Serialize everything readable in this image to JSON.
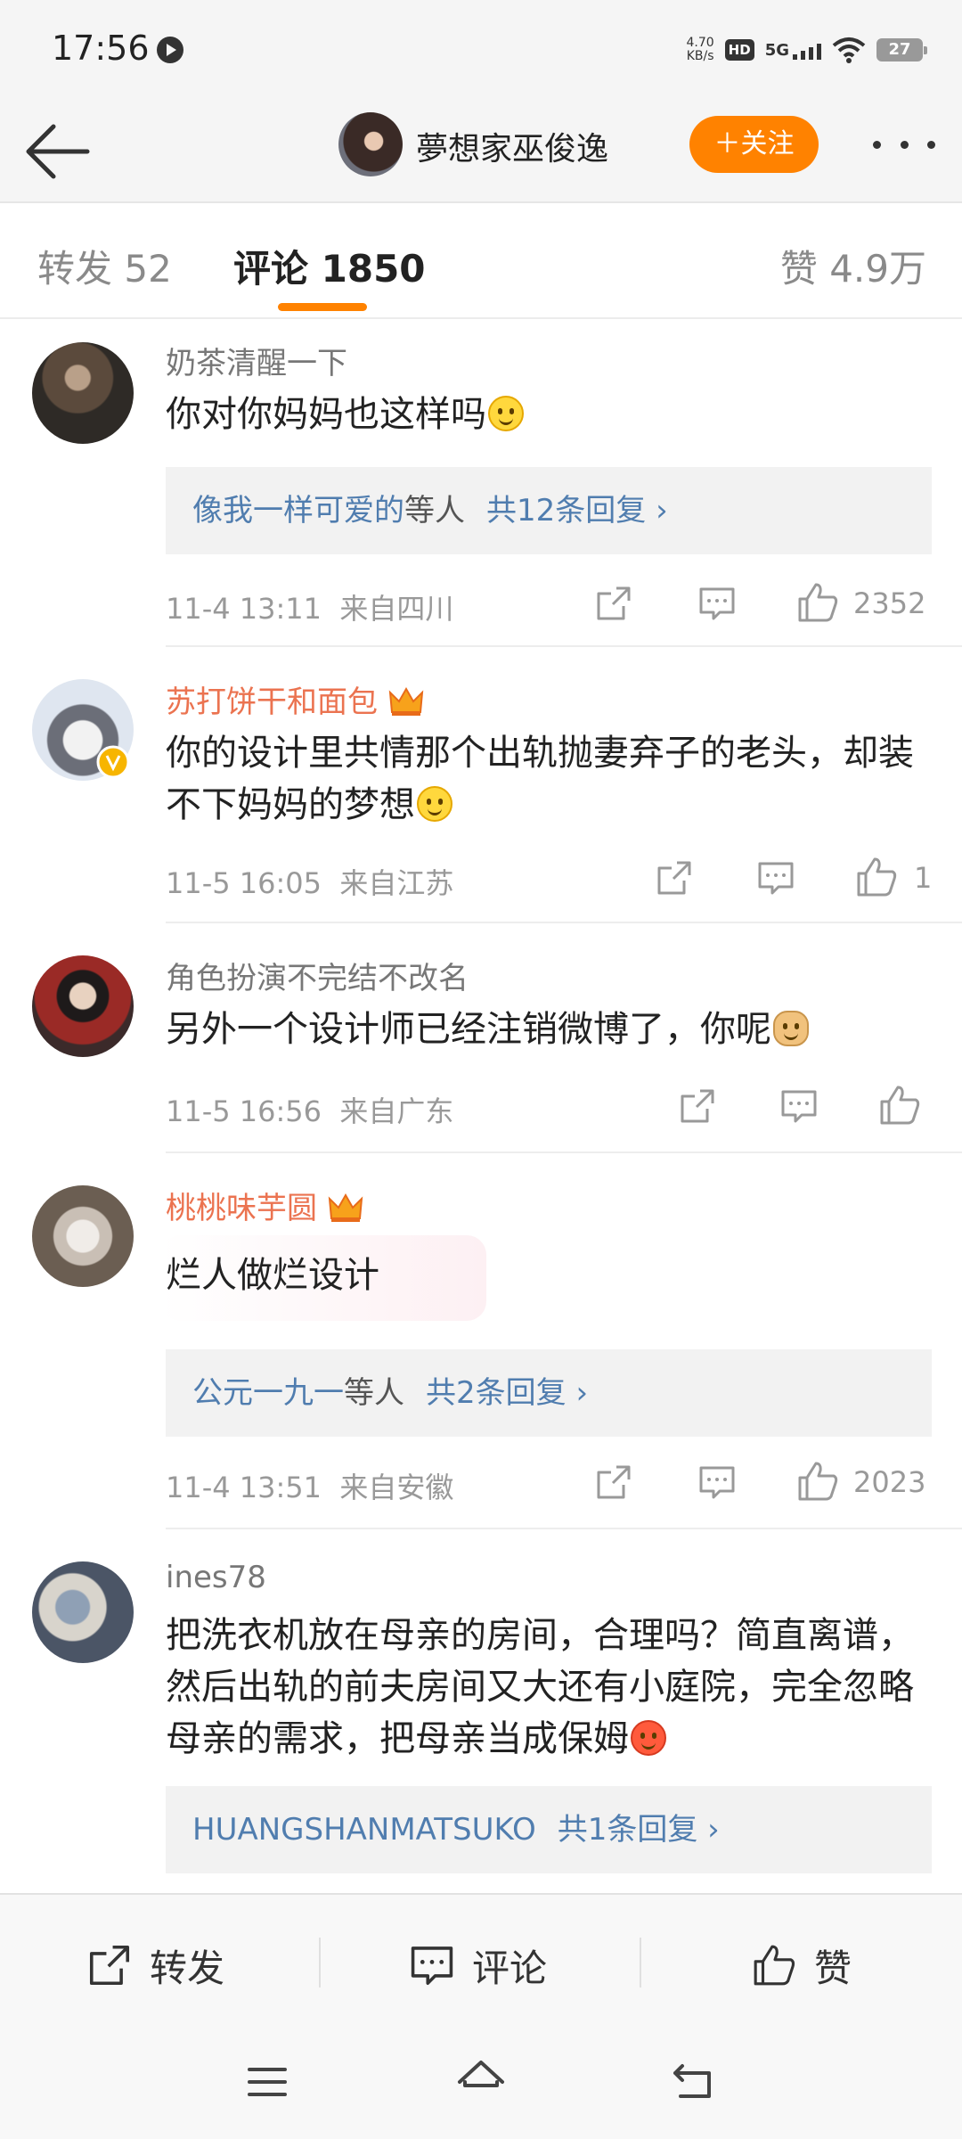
{
  "status_bar": {
    "time": "17:56",
    "net_speed_value": "4.70",
    "net_speed_unit": "KB/s",
    "hd_label": "HD",
    "network_label": "5G",
    "battery": "27"
  },
  "header": {
    "username": "夢想家巫俊逸",
    "follow_label": "＋关注"
  },
  "tabs": {
    "repost": "转发 52",
    "comment": "评论 1850",
    "likes": "赞 4.9万"
  },
  "comments": [
    {
      "username": "奶茶清醒一下",
      "text": "你对你妈妈也这样吗",
      "emoji": "smile-emoji",
      "replies": {
        "users": "像我一样可爱的",
        "etc": "等人",
        "count": "共12条回复 ›"
      },
      "time": "11-4 13:11",
      "location": "来自四川",
      "likes": "2352"
    },
    {
      "username": "苏打饼干和面包",
      "vip": true,
      "verified": true,
      "text": "你的设计里共情那个出轨抛妻弃子的老头，却装不下妈妈的梦想",
      "emoji": "smile-emoji",
      "time": "11-5 16:05",
      "location": "来自江苏",
      "likes": "1"
    },
    {
      "username": "角色扮演不完结不改名",
      "text": "另外一个设计师已经注销微博了，你呢",
      "emoji": "doge-emoji",
      "time": "11-5 16:56",
      "location": "来自广东",
      "likes": ""
    },
    {
      "username": "桃桃味芋圆",
      "vip": true,
      "text": "烂人做烂设计",
      "replies": {
        "users": "公元一九一",
        "etc": "等人",
        "count": "共2条回复 ›"
      },
      "time": "11-4 13:51",
      "location": "来自安徽",
      "likes": "2023"
    },
    {
      "username": "ines78",
      "text": "把洗衣机放在母亲的房间，合理吗？简直离谱，然后出轨的前夫房间又大还有小庭院，完全忽略母亲的需求，把母亲当成保姆",
      "emoji": "angry-emoji",
      "replies": {
        "users": "HUANGSHANMATSUKO",
        "etc": "",
        "count": "共1条回复 ›"
      }
    }
  ],
  "bottom_bar": {
    "repost": "转发",
    "comment": "评论",
    "like": "赞"
  },
  "colors": {
    "accent": "#ff8200",
    "link": "#507daf",
    "vip_name": "#eb7350",
    "meta": "#999999"
  }
}
